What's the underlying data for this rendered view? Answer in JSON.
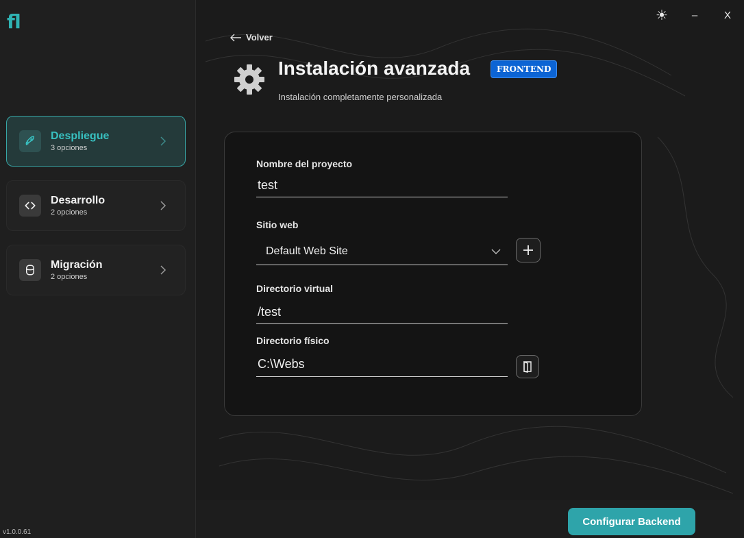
{
  "app": {
    "version": "v1.0.0.61",
    "logo_text": "fl"
  },
  "window_controls": {
    "theme": "☀",
    "minimize": "–",
    "close": "X"
  },
  "sidebar": {
    "items": [
      {
        "title": "Despliegue",
        "subtitle": "3 opciones",
        "icon": "rocket-icon",
        "active": true
      },
      {
        "title": "Desarrollo",
        "subtitle": "2 opciones",
        "icon": "code-icon",
        "active": false
      },
      {
        "title": "Migración",
        "subtitle": "2 opciones",
        "icon": "database-icon",
        "active": false
      }
    ]
  },
  "header": {
    "back_label": "Volver",
    "title": "Instalación avanzada",
    "badge": "FRONTEND",
    "subtitle": "Instalación completamente personalizada"
  },
  "form": {
    "project_name": {
      "label": "Nombre del proyecto",
      "value": "test"
    },
    "website": {
      "label": "Sitio web",
      "value": "Default Web Site"
    },
    "virtual_dir": {
      "label": "Directorio virtual",
      "value": "/test"
    },
    "physical_dir": {
      "label": "Directorio físico",
      "value": "C:\\Webs"
    }
  },
  "footer": {
    "primary_label": "Configurar Backend"
  },
  "colors": {
    "accent": "#2ea4aa",
    "badge": "#0c64d4",
    "background": "#1b1b1b"
  }
}
